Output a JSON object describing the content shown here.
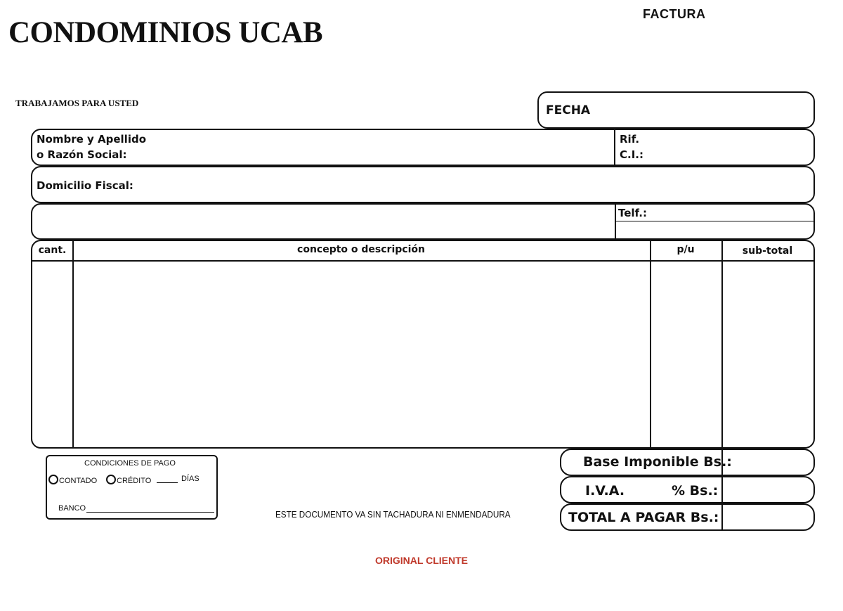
{
  "header": {
    "company": "CONDOMINIOS UCAB",
    "tagline": "TRABAJAMOS PARA USTED",
    "doc_type": "FACTURA"
  },
  "client": {
    "fecha_label": "FECHA",
    "name_label_line1": "Nombre y Apellido",
    "name_label_line2": "o Razón Social:",
    "rif_label": "Rif.",
    "ci_label": "C.I.:",
    "domicilio_label": "Domicilio Fiscal:",
    "telf_label": "Telf.:"
  },
  "items_table": {
    "columns": [
      "cant.",
      "concepto o descripción",
      "p/u",
      "sub-total"
    ]
  },
  "payment": {
    "title": "CONDICIONES DE PAGO",
    "contado": "CONTADO",
    "credito": "CRÉDITO",
    "dias": "DÍAS",
    "banco": "BANCO"
  },
  "totals": {
    "base_label": "Base Imponible Bs.:",
    "iva_label": "I.V.A.",
    "iva_pct_label": "% Bs.:",
    "total_label": "TOTAL A PAGAR Bs.:"
  },
  "footer": {
    "note": "ESTE DOCUMENTO VA SIN TACHADURA NI ENMENDADURA",
    "copy_label": "ORIGINAL CLIENTE"
  }
}
